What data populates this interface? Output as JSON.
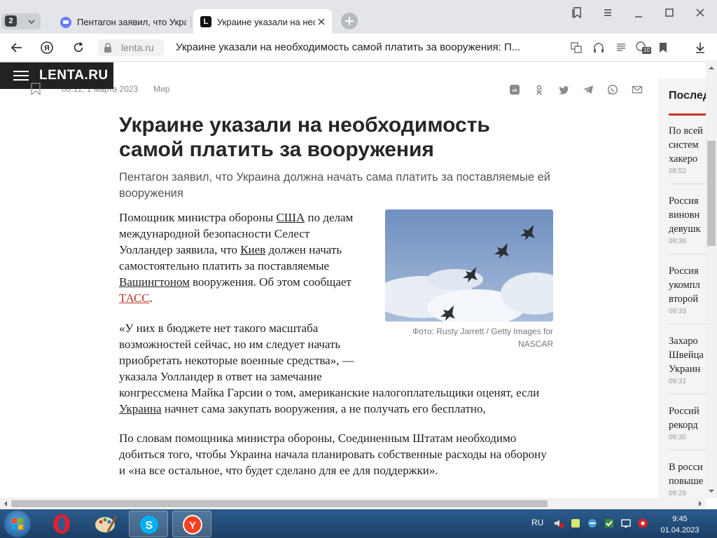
{
  "browser": {
    "tab_count": "2",
    "tabs": [
      {
        "label": "Пентагон заявил, что Укра"
      },
      {
        "label": "Украине указали на нео",
        "favicon_letter": "L"
      }
    ],
    "domain": "lenta.ru",
    "page_title": "Украине указали на необходимость самой платить за вооружения: П...",
    "downloads_badge": "10"
  },
  "site": {
    "brand": "LENTA.RU"
  },
  "article": {
    "time": "08:11, 1 марта 2023",
    "rubric": "Мир",
    "title": "Украине указали на необходимость самой платить за вооружения",
    "lead": "Пентагон заявил, что Украина должна начать сама платить за поставляемые ей вооружения",
    "p1": {
      "a": "Помощник министра обороны ",
      "usa": "США",
      "b": " по делам международной безопасности Селест Уолландер заявила, что ",
      "kiev": "Киев",
      "c": " должен начать самостоятельно платить за поставляемые ",
      "wash": "Вашингтоном",
      "d": " вооружения. Об этом сообщает ",
      "tass": "ТАСС",
      "e": "."
    },
    "p2": {
      "a": "«У них в бюджете нет такого масштаба возможностей сейчас, но им следует начать приобретать некоторые военные средства», — указала Уолландер в ответ на замечание конгрессмена Майка Гарсии о том, американские налогоплательщики оценят, если ",
      "ukraine": "Украина",
      "b": " начнет сама закупать вооружения, а не получать его бесплатно,"
    },
    "p3": "По словам помощника министра обороны, Соединенным Штатам необходимо добиться того, чтобы Украина начала планировать собственные расходы на оборону и «на все остальное, что будет сделано для ее для поддержки».",
    "photo_caption": "Фото: Rusty Jarrett / Getty Images for NASCAR"
  },
  "sidebar": {
    "heading": "Последние новости",
    "items": [
      {
        "lines": [
          "По всей",
          "систем",
          "хакеро"
        ],
        "time": "08:52"
      },
      {
        "lines": [
          "Россия",
          "виновн",
          "девушк"
        ],
        "time": "09:36"
      },
      {
        "lines": [
          "Россия",
          "укомпл",
          "второй"
        ],
        "time": "09:33"
      },
      {
        "lines": [
          "Захаро",
          "Швейца",
          "Украин"
        ],
        "time": "09:31"
      },
      {
        "lines": [
          "Россий",
          "рекорд"
        ],
        "time": "09:30"
      },
      {
        "lines": [
          "В росси",
          "повыше"
        ],
        "time": "09:29"
      }
    ]
  },
  "taskbar": {
    "lang": "RU",
    "time": "9:45",
    "date": "01.04.2023"
  },
  "colors": {
    "accent_red": "#c9302c",
    "logo_bg": "#222222"
  }
}
